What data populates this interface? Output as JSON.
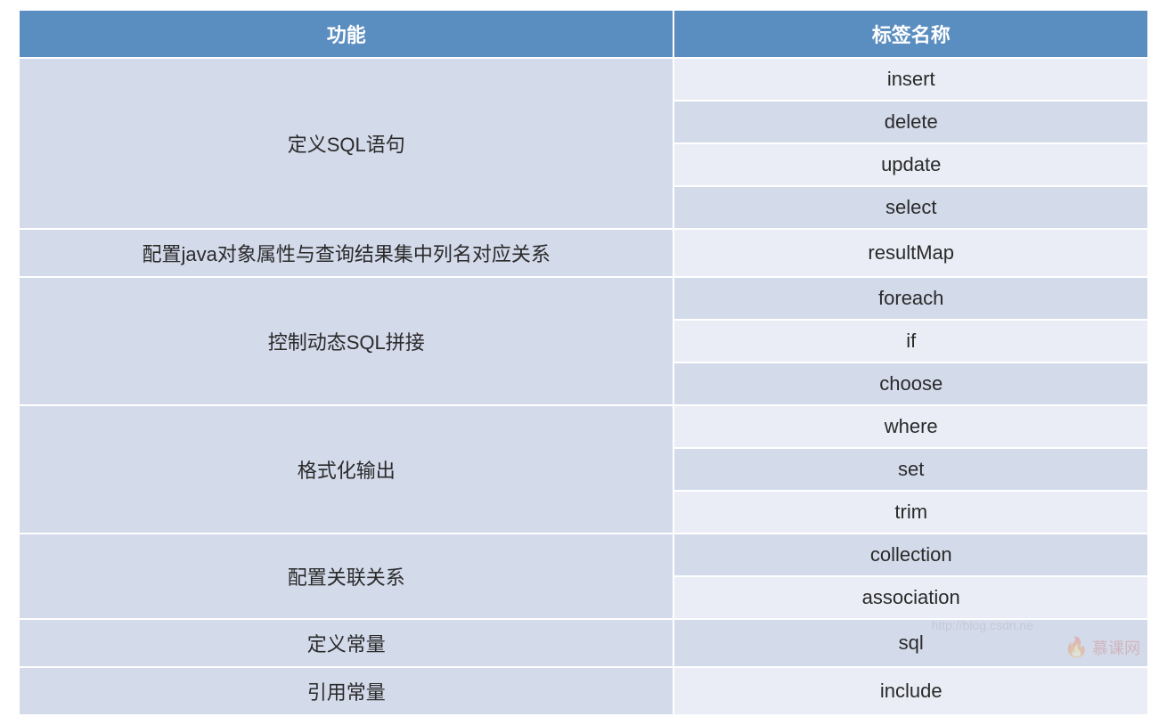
{
  "table": {
    "headers": [
      "功能",
      "标签名称"
    ],
    "groups": [
      {
        "func": "定义SQL语句",
        "tags": [
          "insert",
          "delete",
          "update",
          "select"
        ]
      },
      {
        "func": "配置java对象属性与查询结果集中列名对应关系",
        "tags": [
          "resultMap"
        ]
      },
      {
        "func": "控制动态SQL拼接",
        "tags": [
          "foreach",
          "if",
          "choose"
        ]
      },
      {
        "func": "格式化输出",
        "tags": [
          "where",
          "set",
          "trim"
        ]
      },
      {
        "func": "配置关联关系",
        "tags": [
          "collection",
          "association"
        ]
      },
      {
        "func": "定义常量",
        "tags": [
          "sql"
        ]
      },
      {
        "func": "引用常量",
        "tags": [
          "include"
        ]
      }
    ]
  },
  "watermark": {
    "url": "http://blog.csdn.ne",
    "brand": "慕课网"
  }
}
